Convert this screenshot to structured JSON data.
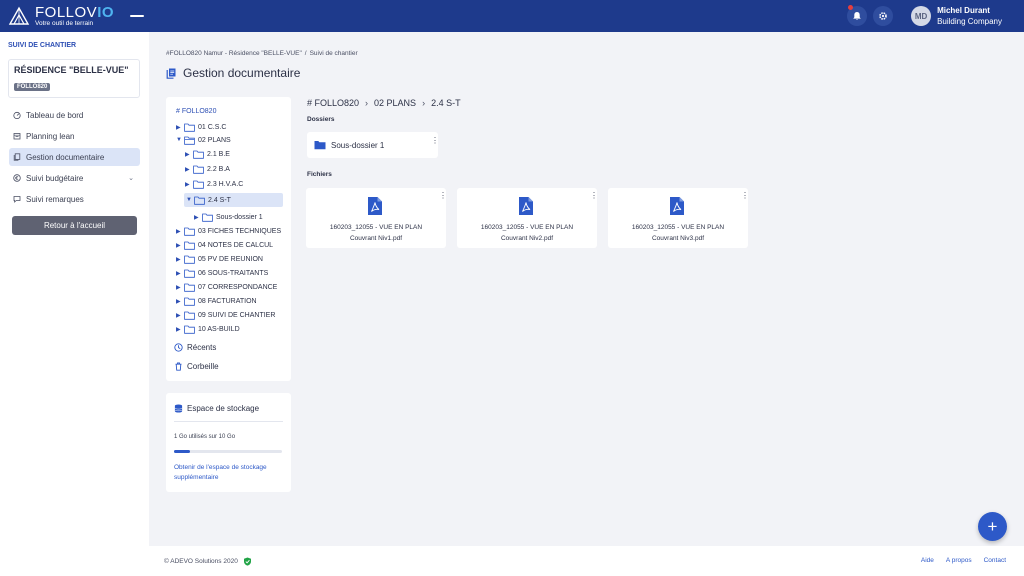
{
  "app": {
    "name_main": "FOLLOV",
    "name_accent": "IO",
    "tagline": "Votre outil de terrain"
  },
  "header": {
    "avatar_initials": "MD",
    "user_name": "Michel Durant",
    "company": "Building Company"
  },
  "sidebar": {
    "section_label": "SUIVI DE CHANTIER",
    "project_name": "RÉSIDENCE \"BELLE-VUE\"",
    "project_code": "FOLLO820",
    "items": [
      {
        "label": "Tableau de bord",
        "icon": "dashboard-icon"
      },
      {
        "label": "Planning lean",
        "icon": "calendar-icon"
      },
      {
        "label": "Gestion documentaire",
        "icon": "documents-icon",
        "active": true
      },
      {
        "label": "Suivi budgétaire",
        "icon": "euro-icon"
      },
      {
        "label": "Suivi remarques",
        "icon": "comment-icon"
      }
    ],
    "home_button": "Retour à l'accueil"
  },
  "breadcrumb": {
    "part1": "#FOLLO820 Namur - Résidence \"BELLE-VUE\"",
    "separator": "/",
    "part2": "Suivi de chantier"
  },
  "page_title": "Gestion documentaire",
  "tree": {
    "root": "# FOLLO820",
    "nodes": [
      {
        "label": "01 C.S.C",
        "level": 0
      },
      {
        "label": "02 PLANS",
        "level": 0,
        "expanded": true
      },
      {
        "label": "2.1 B.E",
        "level": 1
      },
      {
        "label": "2.2 B.A",
        "level": 1
      },
      {
        "label": "2.3 H.V.A.C",
        "level": 1
      },
      {
        "label": "2.4 S-T",
        "level": 1,
        "selected": true
      },
      {
        "label": "Sous-dossier 1",
        "level": 2
      },
      {
        "label": "03 FICHES TECHNIQUES",
        "level": 0
      },
      {
        "label": "04 NOTES DE CALCUL",
        "level": 0
      },
      {
        "label": "05 PV DE REUNION",
        "level": 0
      },
      {
        "label": "06 SOUS-TRAITANTS",
        "level": 0
      },
      {
        "label": "07 CORRESPONDANCE",
        "level": 0
      },
      {
        "label": "08 FACTURATION",
        "level": 0
      },
      {
        "label": "09 SUIVI DE CHANTIER",
        "level": 0
      },
      {
        "label": "10 AS-BUILD",
        "level": 0
      }
    ],
    "recent_label": "Récents",
    "trash_label": "Corbeille"
  },
  "storage": {
    "title": "Espace de stockage",
    "usage_text": "1 Go utilisés sur 10 Go",
    "used_fraction": 0.15,
    "link_text": "Obtenir de l'espace de stockage supplémentaire"
  },
  "content": {
    "path": [
      "# FOLLO820",
      "02 PLANS",
      "2.4 S-T"
    ],
    "folders_label": "Dossiers",
    "folders": [
      {
        "name": "Sous-dossier 1"
      }
    ],
    "files_label": "Fichiers",
    "files": [
      {
        "line1": "160203_12055 - VUE EN PLAN",
        "line2": "Couvrant Niv1.pdf"
      },
      {
        "line1": "160203_12055 - VUE EN PLAN",
        "line2": "Couvrant Niv2.pdf"
      },
      {
        "line1": "160203_12055 - VUE EN PLAN",
        "line2": "Couvrant Niv3.pdf"
      }
    ]
  },
  "footer": {
    "copyright": "© ADEVO Solutions 2020",
    "links": [
      "Aide",
      "A propos",
      "Contact"
    ]
  },
  "fab_label": "+",
  "colors": {
    "topbar": "#1e3a8c",
    "accent": "#2d59c8",
    "active_bg": "#dbe4f7"
  }
}
